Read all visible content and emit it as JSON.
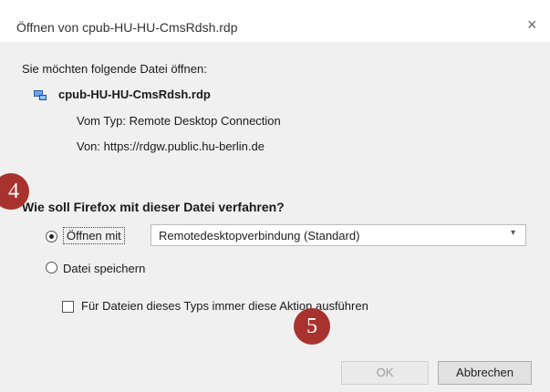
{
  "dialog": {
    "title": "Öffnen von cpub-HU-HU-CmsRdsh.rdp",
    "close_glyph": "×",
    "intro": "Sie möchten folgende Datei öffnen:",
    "file_icon": "rdp-file-icon",
    "filename": "cpub-HU-HU-CmsRdsh.rdp",
    "type_line": "Vom Typ: Remote Desktop Connection",
    "from_line": "Von: https://rdgw.public.hu-berlin.de",
    "question": "Wie soll Firefox mit dieser Datei verfahren?",
    "open_with": {
      "label": "Öffnen mit",
      "selected": true,
      "app_value": "Remotedesktopverbindung (Standard)",
      "arrow": "▾"
    },
    "save_file": {
      "label": "Datei speichern",
      "selected": false
    },
    "always_do": {
      "label": "Für Dateien dieses Typs immer diese Aktion ausführen",
      "checked": false
    },
    "buttons": {
      "ok": "OK",
      "cancel": "Abbrechen",
      "ok_enabled": false
    }
  },
  "markers": {
    "step4": "4",
    "step5": "5"
  },
  "colors": {
    "dialog_bg": "#f0f0f0",
    "title_bg": "#ffffff",
    "marker": "#a8322d",
    "accent_icon": "#2a5db0"
  }
}
